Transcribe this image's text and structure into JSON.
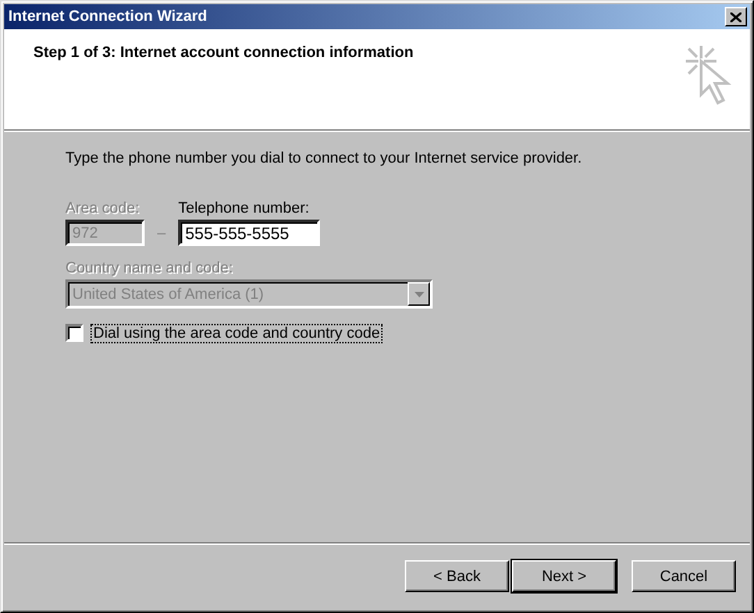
{
  "window": {
    "title": "Internet Connection Wizard"
  },
  "header": {
    "step_title": "Step 1 of 3: Internet account connection information"
  },
  "instructions": "Type the phone number you dial to connect to your Internet service provider.",
  "area_code": {
    "label": "Area code:",
    "value": "972",
    "disabled": true
  },
  "separator": "–",
  "telephone": {
    "label": "Telephone number:",
    "value": "555-555-5555",
    "disabled": false
  },
  "country": {
    "label": "Country name and code:",
    "value": "United States of America (1)",
    "disabled": true
  },
  "dial_option": {
    "label": "Dial using the area code and country code",
    "checked": false
  },
  "buttons": [
    {
      "label": "< Back",
      "default": false
    },
    {
      "label": "Next >",
      "default": true
    },
    {
      "label": "Cancel",
      "default": false
    }
  ]
}
